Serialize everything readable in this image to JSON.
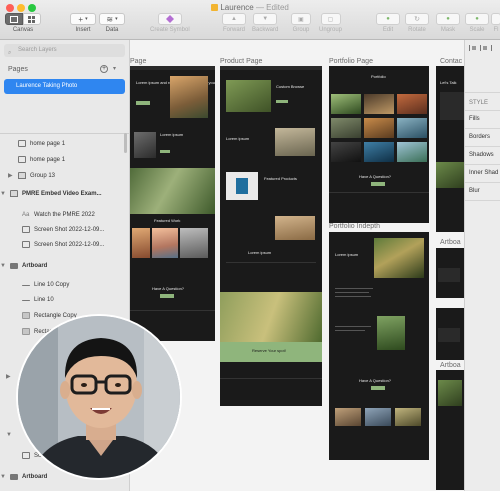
{
  "window": {
    "title": "Laurence",
    "edited": "— Edited"
  },
  "toolbar": {
    "canvas_label": "Canvas",
    "insert_label": "Insert",
    "data_label": "Data",
    "create_symbol_label": "Create Symbol",
    "forward_label": "Forward",
    "backward_label": "Backward",
    "group_label": "Group",
    "ungroup_label": "Ungroup",
    "edit_label": "Edit",
    "rotate_label": "Rotate",
    "mask_label": "Mask",
    "scale_label": "Scale",
    "flatten_label": "Fl"
  },
  "sidebar": {
    "search_placeholder": "Search Layers",
    "pages_header": "Pages",
    "selected_page": "Laurence Taking Photo",
    "layers": [
      {
        "name": "home page 1",
        "icon": "image-icon"
      },
      {
        "name": "home page 1",
        "icon": "image-icon"
      },
      {
        "name": "Group 13",
        "icon": "folder-icon"
      },
      {
        "name": "PMRE Embed Video Exam...",
        "icon": "folder-icon"
      },
      {
        "name": "Watch the PMRE 2022",
        "icon": "text-icon"
      },
      {
        "name": "Screen Shot 2022-12-09...",
        "icon": "image-icon"
      },
      {
        "name": "Screen Shot 2022-12-09...",
        "icon": "image-icon"
      },
      {
        "name": "Artboard",
        "icon": "artboard-icon"
      },
      {
        "name": "Line 10 Copy",
        "icon": "line-icon"
      },
      {
        "name": "Line 10",
        "icon": "line-icon"
      },
      {
        "name": "Rectangle Copy",
        "icon": "rectangle-icon"
      },
      {
        "name": "Rectangle",
        "icon": "rectangle-icon"
      },
      {
        "name": "Scre",
        "icon": "image-icon"
      },
      {
        "name": "Artboard",
        "icon": "artboard-icon"
      }
    ]
  },
  "canvas": {
    "artboard_labels": [
      "Page",
      "Product Page",
      "Portfolio Page",
      "Contac",
      "Portfolio Indepth",
      "Artboa"
    ],
    "page_text": {
      "hero_heading": "Lorem ipsum and reliable to bespoke for you",
      "section_featured": "Featured Work",
      "question": "Have A Question?",
      "portfolio": "Portfolio",
      "custom_browse": "Custom Browse",
      "featured_products": "Featured Products",
      "question_2": "Have A Question?",
      "reserve": "Reserve Your spot!",
      "contact": "Let's Talk",
      "lorem": "Lorem ipsum"
    }
  },
  "inspector": {
    "style": "STYLE",
    "fills": "Fills",
    "borders": "Borders",
    "shadows": "Shadows",
    "inner_shadows": "Inner Shad",
    "blur": "Blur"
  },
  "colors": {
    "accent": "#2f86f0",
    "artboard_dark": "#1a1a1a",
    "sage_green": "#8fb57c"
  }
}
